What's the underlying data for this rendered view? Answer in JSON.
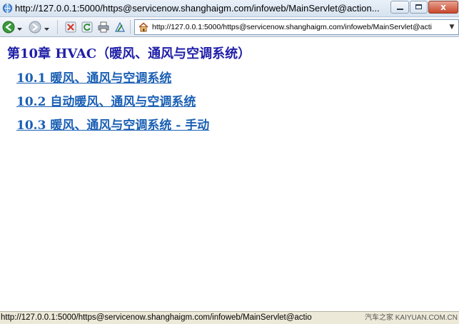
{
  "window": {
    "title": "http://127.0.0.1:5000/https@servicenow.shanghaigm.com/infoweb/MainServlet@action...",
    "close_label": "x"
  },
  "toolbar": {
    "address_url": "http://127.0.0.1:5000/https@servicenow.shanghaigm.com/infoweb/MainServlet@acti"
  },
  "icons": {
    "back": "back-arrow-icon",
    "forward": "forward-arrow-icon",
    "stop": "stop-icon",
    "refresh": "refresh-icon",
    "print": "printer-icon",
    "home": "home-icon"
  },
  "content": {
    "chapter_title": "第10章 HVAC（暖风、通风与空调系统）",
    "links": [
      {
        "label": "10.1 暖风、通风与空调系统"
      },
      {
        "label": "10.2 自动暖风、通风与空调系统"
      },
      {
        "label": "10.3 暖风、通风与空调系统 - 手动"
      }
    ]
  },
  "statusbar": {
    "text": "http://127.0.0.1:5000/https@servicenow.shanghaigm.com/infoweb/MainServlet@actio",
    "watermark": "汽车之家 KAIYUAN.COM.CN"
  },
  "colors": {
    "chapter_title": "#1f1fa8",
    "link": "#1a5fb4",
    "statusbar_bg": "#ece9d8"
  }
}
